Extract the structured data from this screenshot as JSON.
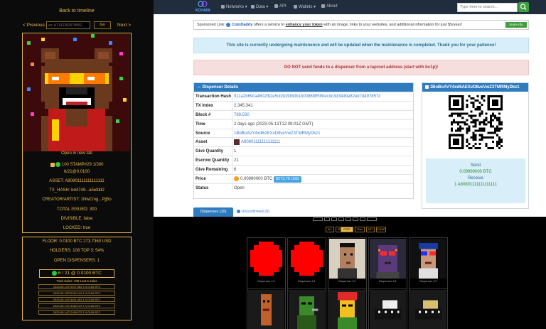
{
  "left": {
    "back_label": "Back to timeline",
    "prev_label": "< Previous",
    "next_label": "Next >",
    "search_placeholder": "ex: A7142282578952",
    "go_label": "Go",
    "open_new_tab": "Open in new tab",
    "status_line": "100  STAMP#29   1/300",
    "date_line": "6/21@0.0100",
    "asset_line": "ASSET: A80801111111111111",
    "txhash_line": "TX_HASH: bd4749...a5efdd2",
    "creator_line": "CREATOR/ARTIST: 1NwCmg...Pjj5o",
    "issued_line": "TOTAL ISSUED: 300",
    "divisible_line": "DIVISIBLE: false",
    "locked_line": "LOCKED: true",
    "floor_line": "FLOOR: 0.0100 BTC 273.7360 USD",
    "holders_line": "HOLDERS: 108  TOP 3: 54%",
    "dispensers_line": "OPEN DISPENSERS: 1",
    "buy_label": "6 / 21 @ 0.0100 BTC",
    "last_sales_title": "Total Sales: 108    Last 5 sales",
    "sales": [
      "2023-05-13T19:07:06Z  1  0.0100 BTC",
      "2023-05-15T02:52:19Z  1  0.0100 BTC",
      "2023-05-14T18:01:45Z  1  0.0100 BTC",
      "2023-05-14T15:56:12Z  1  0.0100 BTC",
      "2023-05-14T12:08:27Z  1  0.0100 BTC"
    ]
  },
  "browser": {
    "logo": "XCHAIN",
    "nav": [
      "Networks",
      "Data",
      "API",
      "Wallets",
      "About"
    ],
    "search_placeholder": "Type here to search...",
    "sponsor_prefix": "Sponsored Link:",
    "sponsor_brand": "CoinDaddy",
    "sponsor_mid": " offers a service to ",
    "sponsor_link": "enhance your token",
    "sponsor_tail": " with an image, links to your websites, and additional information for just $5/year!",
    "sponsor_more": "more info",
    "maintenance": "This site is currently undergoing maintenence and will be updated when the maintenance is completed. Thank you for your patience!",
    "warning": "DO NOT send funds to a dispenser from a taproot address (start with bc1p)!",
    "details_title": "Dispenser Details",
    "details": [
      {
        "k": "Transaction Hash",
        "v": "911a2b69ca4602fb2e5cb3d3380b1b00869ff590ecdc3d34dbe82ed7d497857c",
        "link": true
      },
      {
        "k": "TX Index",
        "v": "2,345,341",
        "link": false
      },
      {
        "k": "Block #",
        "v": "789,530",
        "link": true
      },
      {
        "k": "Time",
        "v": "2 days ago (2023-05-13T12:09:01Z GMT)",
        "link": false
      },
      {
        "k": "Source",
        "v": "1BoBoAVY4xd6AEXvD8veVwZ3TMRMyDkz1",
        "link": true
      },
      {
        "k": "Asset",
        "v": "A80801111111111111",
        "link": true
      },
      {
        "k": "Give Quantity",
        "v": "1",
        "link": false
      },
      {
        "k": "Escrow Quantity",
        "v": "21",
        "link": false
      },
      {
        "k": "Give Remaining",
        "v": "6",
        "link": false
      },
      {
        "k": "Price",
        "v": "0.00990000 BTC",
        "link": false
      },
      {
        "k": "Status",
        "v": "Open",
        "link": false
      }
    ],
    "price_usd": "$273.75 USD",
    "qr_title": "1BoBoAVY4xd6AEXvD8veVwZ3TMRMyDkz1",
    "send_label": "Send",
    "send_value": "0.09999000 BTC",
    "receive_label": "Receive",
    "receive_value": "1 A80801111111111111",
    "tab_dispenses": "Dispenses (10)",
    "tab_unconfirmed": "Unconfirmed (0)"
  },
  "grid": {
    "caption": "Dispenser  1/1",
    "filters": [
      "ALL",
      "SRC-20",
      "PEPE",
      "Pixel",
      "ART",
      "CLEAR"
    ]
  }
}
